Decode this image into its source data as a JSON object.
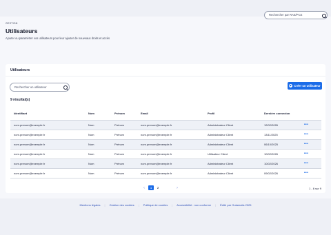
{
  "header": {
    "search_placeholder": "Rechercher par RAE/PCE"
  },
  "breadcrumb": "GESTION",
  "page": {
    "title": "Utilisateurs",
    "subtitle": "Ajouter ou paramétrer vos utilisateurs pour leur ajouter de nouveaux droits et accès"
  },
  "card": {
    "title": "Utilisateurs",
    "search_placeholder": "Rechercher un utilisateur",
    "create_label": "Créer un utilisateur",
    "results": "9 résultat(s)"
  },
  "table": {
    "columns": [
      "Identifiant",
      "Nom",
      "Prénom",
      "Email",
      "Profil",
      "Dernière connexion"
    ],
    "rows": [
      [
        "nom.prenom@exemple.fr",
        "Nom",
        "Prénom",
        "nom.prenom@exemple.fr",
        "Administrateur Client",
        "12/02/2026"
      ],
      [
        "nom.prenom@exemple.fr",
        "Nom",
        "Prénom",
        "nom.prenom@exemple.fr",
        "Administrateur Client",
        "13/11/2025"
      ],
      [
        "nom.prenom@exemple.fr",
        "Nom",
        "Prénom",
        "nom.prenom@exemple.fr",
        "Administrateur Client",
        "06/10/2025"
      ],
      [
        "nom.prenom@exemple.fr",
        "Nom",
        "Prénom",
        "nom.prenom@exemple.fr",
        "Utilisateur Client",
        "10/02/2026"
      ],
      [
        "nom.prenom@exemple.fr",
        "Nom",
        "Prénom",
        "nom.prenom@exemple.fr",
        "Administrateur Client",
        "10/02/2026"
      ],
      [
        "nom.prenom@exemple.fr",
        "Nom",
        "Prénom",
        "nom.prenom@exemple.fr",
        "Administrateur Client",
        "09/02/2026"
      ]
    ],
    "row_action": "•••"
  },
  "pagination": {
    "prev": "‹",
    "pages": [
      "1",
      "2"
    ],
    "current": "1",
    "next": "›",
    "range": "1 - 6 sur 9"
  },
  "footer": {
    "links": [
      "Mentions légales",
      "Gestion des cookies",
      "Politique de cookies",
      "Accessibilité : non conforme",
      "Édité par Outamatis 2025"
    ]
  },
  "colors": {
    "accent": "#1b6ce8",
    "background": "#eef0f6"
  }
}
